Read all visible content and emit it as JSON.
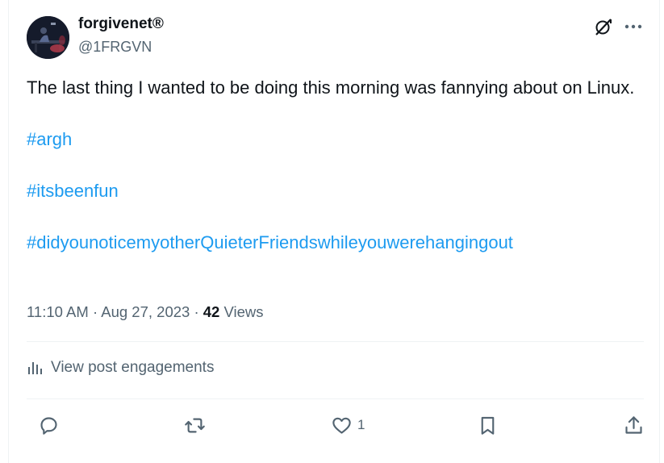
{
  "author": {
    "display_name": "forgivenet®",
    "handle": "@1FRGVN",
    "avatar_icon": "avatar-photo"
  },
  "post": {
    "line1": "The last thing I wanted to be doing this morning was fannying about on Linux.",
    "hashtags": [
      "#argh",
      "#itsbeenfun",
      "#didyounoticemyotherQuieterFriendswhileyouwerehangingout"
    ]
  },
  "meta": {
    "time": "11:10 AM",
    "sep": "·",
    "date": "Aug 27, 2023",
    "views_count": "42",
    "views_label": "Views"
  },
  "engagements_label": "View post engagements",
  "actions": {
    "reply_icon": "reply-icon",
    "repost_icon": "repost-icon",
    "like_icon": "like-icon",
    "like_count": "1",
    "bookmark_icon": "bookmark-icon",
    "share_icon": "share-icon"
  },
  "colors": {
    "link": "#1d9bf0",
    "secondary": "#536471",
    "primary": "#0f1419",
    "divider": "#eff3f4"
  }
}
